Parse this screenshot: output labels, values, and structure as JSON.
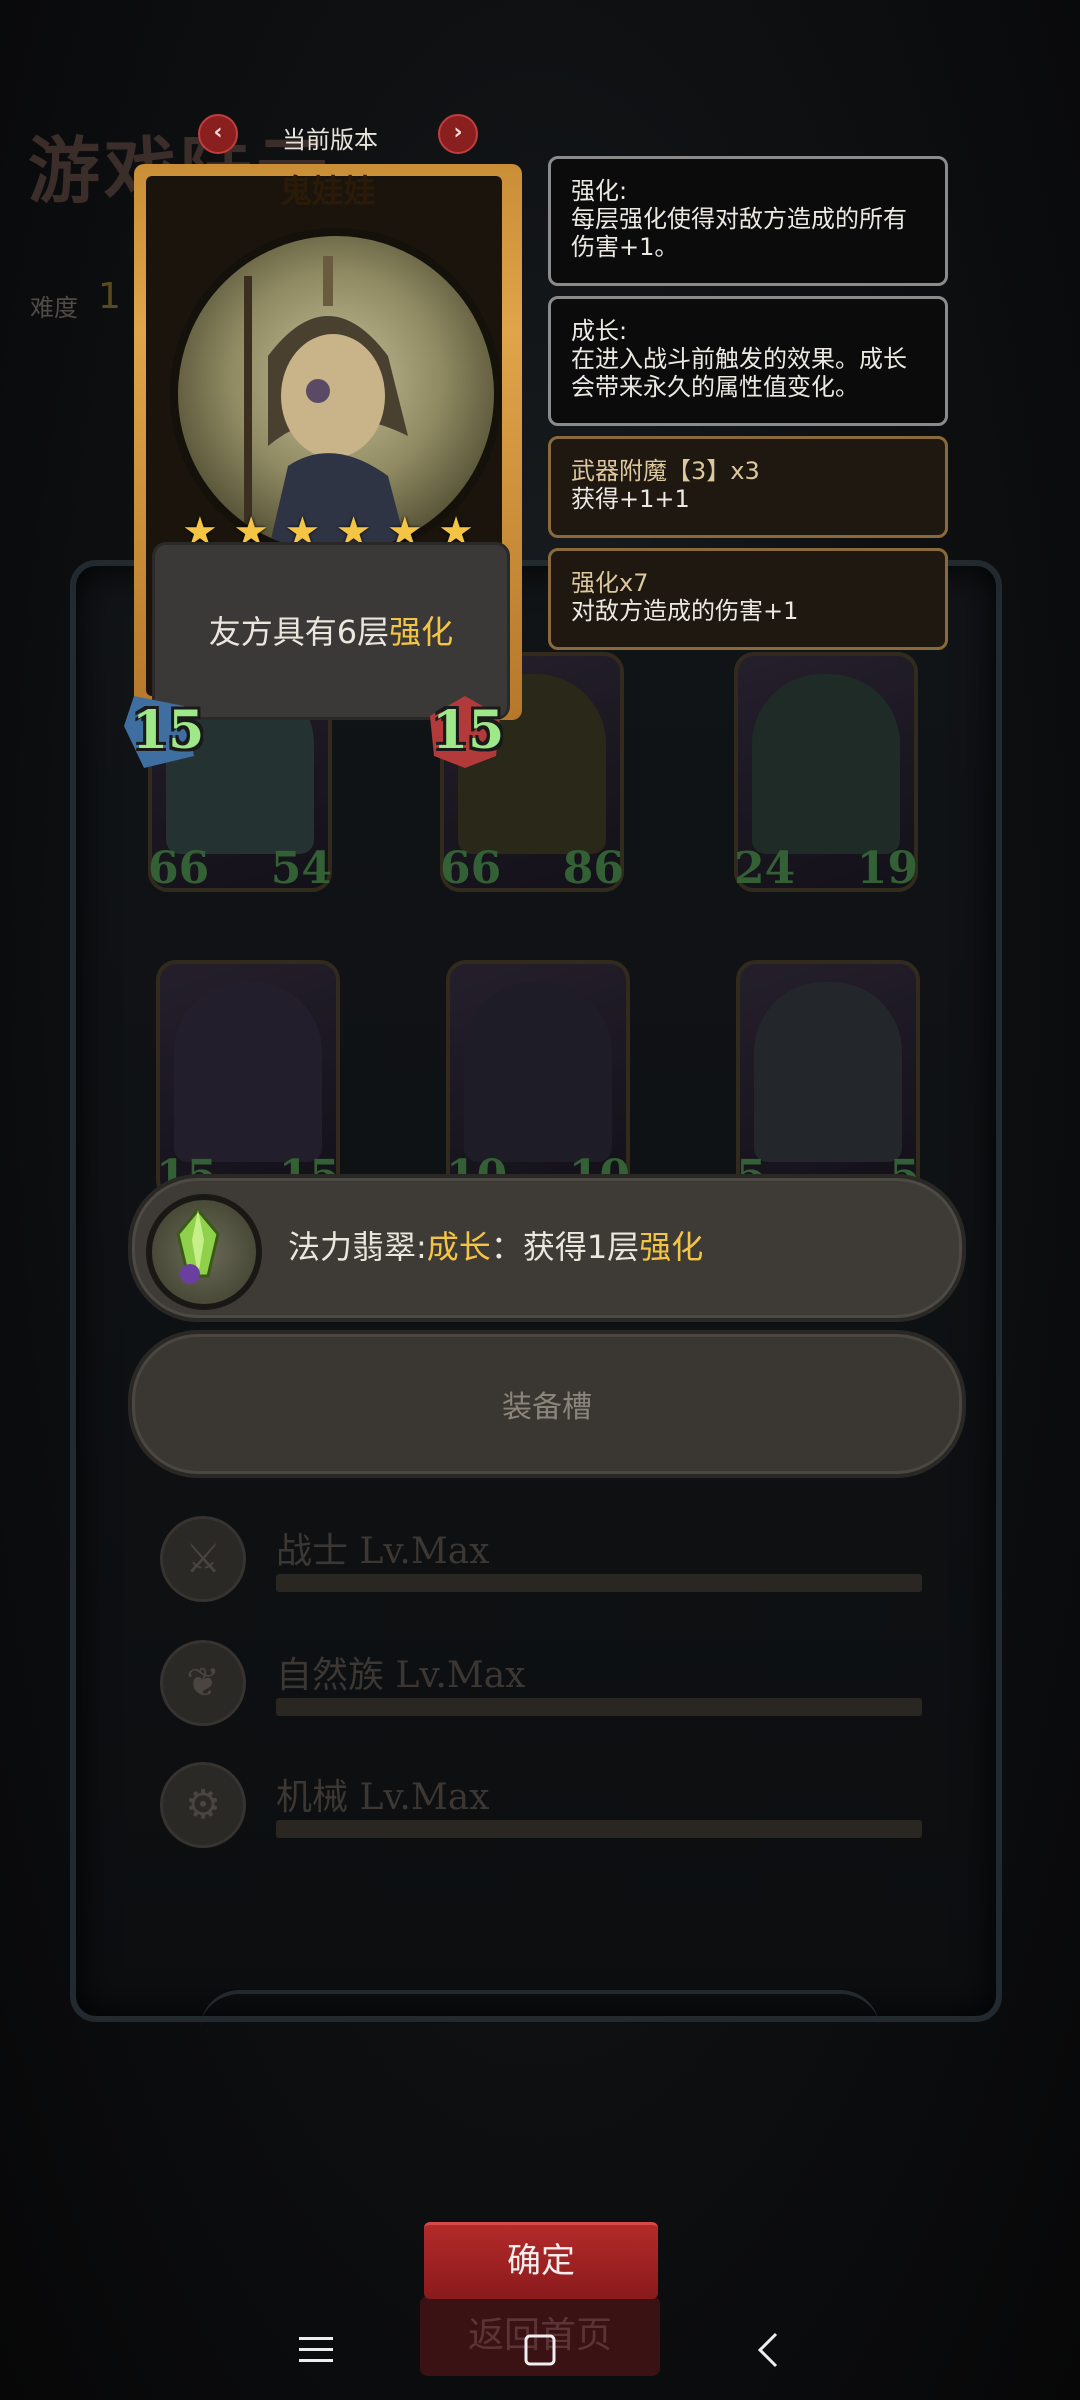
{
  "background": {
    "title_fragment": "游戏陆元",
    "difficulty_label": "难度",
    "difficulty_value": "1",
    "card_grid": [
      {
        "atk": "66",
        "hp": "54",
        "tint": "#2b3d3c"
      },
      {
        "atk": "66",
        "hp": "86",
        "tint": "#33301a"
      },
      {
        "atk": "24",
        "hp": "19",
        "tint": "#23332d"
      },
      {
        "atk": "15",
        "hp": "15",
        "tint": "#2a2333"
      },
      {
        "atk": "10",
        "hp": "10",
        "tint": "#24202c"
      },
      {
        "atk": "5",
        "hp": "5",
        "tint": "#2a2f33"
      }
    ],
    "races": [
      {
        "name": "战士 Lv.Max",
        "icon": "sword-icon"
      },
      {
        "name": "自然族 Lv.Max",
        "icon": "leaf-icon"
      },
      {
        "name": "机械 Lv.Max",
        "icon": "gear-icon"
      }
    ],
    "return_label": "返回首页"
  },
  "version_bar": {
    "label": "当前版本",
    "prev_icon": "chevron-left-icon",
    "next_icon": "chevron-right-icon"
  },
  "card": {
    "name": "鬼娃娃",
    "stars": 6,
    "desc_prefix": "友方具有6层",
    "desc_keyword": "强化",
    "atk": "15",
    "hp": "15"
  },
  "tooltips": [
    {
      "title": "强化:",
      "body": "每层强化使得对敌方造成的所有伤害+1。",
      "style": "black"
    },
    {
      "title": "成长:",
      "body": "在进入战斗前触发的效果。成长会带来永久的属性值变化。",
      "style": "black"
    },
    {
      "title": "武器附魔【3】x3",
      "body": "获得+1+1",
      "style": "brown"
    },
    {
      "title": "强化x7",
      "body": "对敌方造成的伤害+1",
      "style": "brown"
    }
  ],
  "relic": {
    "name": "法力翡翠",
    "colon": ":",
    "keyword1": "成长",
    "mid": "：获得1层",
    "keyword2": "强化",
    "icon": "emerald-icon"
  },
  "equip_slot": {
    "label": "装备槽"
  },
  "confirm": {
    "label": "确定"
  },
  "nav": {
    "menu_icon": "menu-icon",
    "home_icon": "home-square-icon",
    "back_icon": "back-chevron-icon"
  },
  "colors": {
    "accent_yellow": "#f4c445",
    "stat_green": "#9fe88a",
    "confirm_red": "#b42a2a"
  }
}
